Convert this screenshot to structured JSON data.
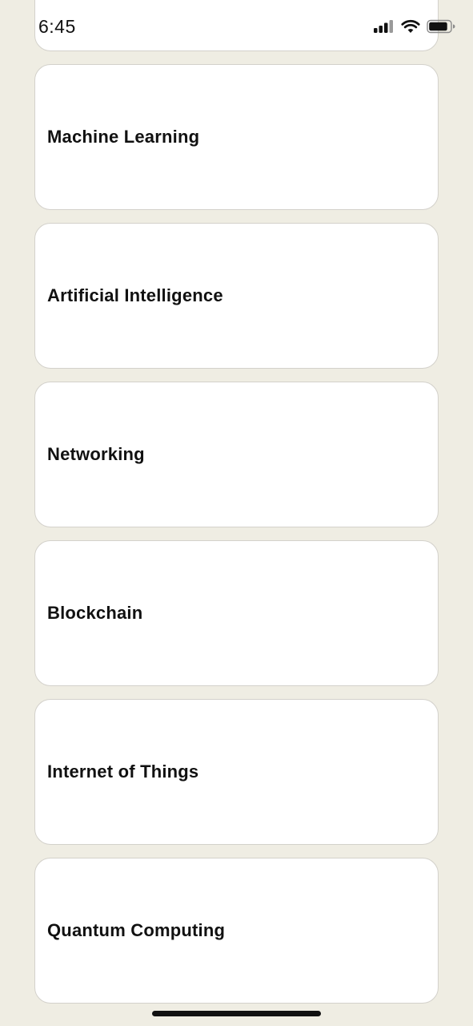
{
  "status_bar": {
    "time": "6:45",
    "icons": [
      "cellular-signal-icon",
      "wifi-icon",
      "battery-icon"
    ]
  },
  "topics": [
    {
      "title": ""
    },
    {
      "title": "Machine Learning"
    },
    {
      "title": "Artificial Intelligence"
    },
    {
      "title": "Networking"
    },
    {
      "title": "Blockchain"
    },
    {
      "title": "Internet of Things"
    },
    {
      "title": "Quantum Computing"
    }
  ],
  "colors": {
    "background": "#efede3",
    "card": "#ffffff",
    "card_border": "#d3d1cb",
    "text": "#111111"
  }
}
